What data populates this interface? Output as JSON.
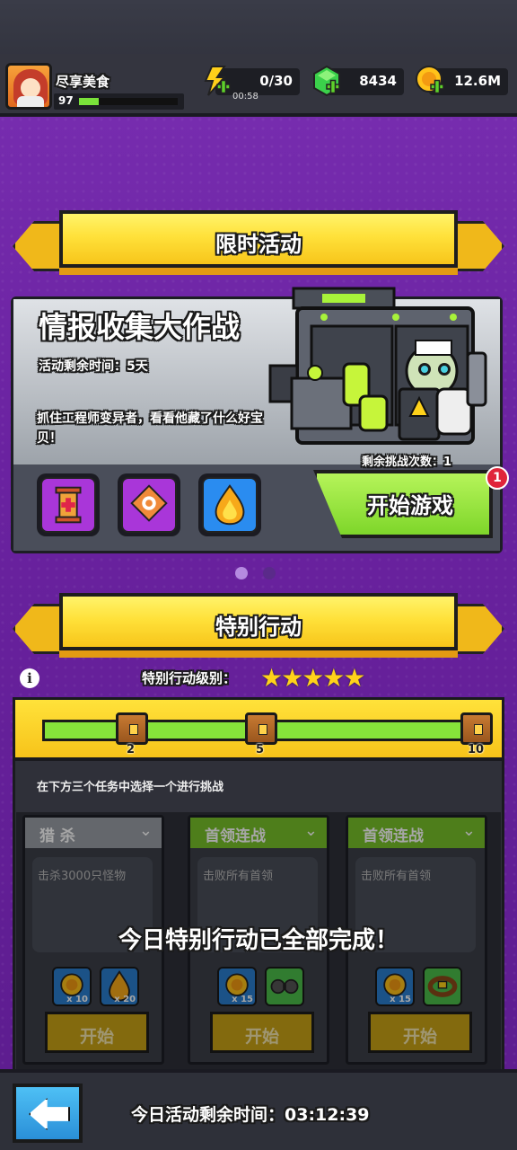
{
  "player": {
    "name": "尽享美食",
    "level": "97",
    "exp_fraction": 0.2
  },
  "resources": {
    "energy": "0/30",
    "energy_timer": "00:58",
    "gems": "8434",
    "coins": "12.6M"
  },
  "limited_event": {
    "banner_label": "限时活动",
    "title": "情报收集大作战",
    "time_left": "活动剩余时间：5天",
    "description": "抓住工程师变异者，看看他藏了什么好宝贝！",
    "remaining_attempts": "剩余挑战次数：1",
    "start_button": "开始游戏",
    "notification_count": "1",
    "rewards": [
      {
        "icon": "scroll-icon",
        "color": "#a936d9"
      },
      {
        "icon": "puzzle-icon",
        "color": "#a936d9"
      },
      {
        "icon": "fire-drop-icon",
        "color": "#2a8cf0"
      }
    ]
  },
  "special_ops": {
    "banner_label": "特别行动",
    "level_label": "特别行动级别：",
    "stars": "★★★★★",
    "star_count": 5,
    "progress_fraction": 1.0,
    "milestones": [
      "2",
      "5",
      "10"
    ],
    "hint": "在下方三个任务中选择一个进行挑战",
    "completed_message": "今日特别行动已全部完成！",
    "tasks": [
      {
        "title": "猎 杀",
        "description": "击杀3000只怪物",
        "header_color": "#9a9ea6",
        "button": "开始",
        "rewards": [
          {
            "icon": "gold-coin-icon",
            "qty": "x 10"
          },
          {
            "icon": "fire-drop-icon",
            "qty": "x 20"
          }
        ]
      },
      {
        "title": "首领连战",
        "description": "击败所有首领",
        "header_color": "#78c22a",
        "button": "开始",
        "rewards": [
          {
            "icon": "gold-coin-icon",
            "qty": "x 15"
          },
          {
            "icon": "goggles-icon",
            "qty": ""
          }
        ]
      },
      {
        "title": "首领连战",
        "description": "击败所有首领",
        "header_color": "#78c22a",
        "button": "开始",
        "rewards": [
          {
            "icon": "gold-coin-icon",
            "qty": "x 15"
          },
          {
            "icon": "belt-icon",
            "qty": ""
          }
        ]
      }
    ]
  },
  "footer": {
    "time_left": "今日活动剩余时间：03:12:39"
  },
  "colors": {
    "accent_yellow": "#ffe13a",
    "accent_green": "#86e33a",
    "bg_purple": "#6a22a0"
  }
}
